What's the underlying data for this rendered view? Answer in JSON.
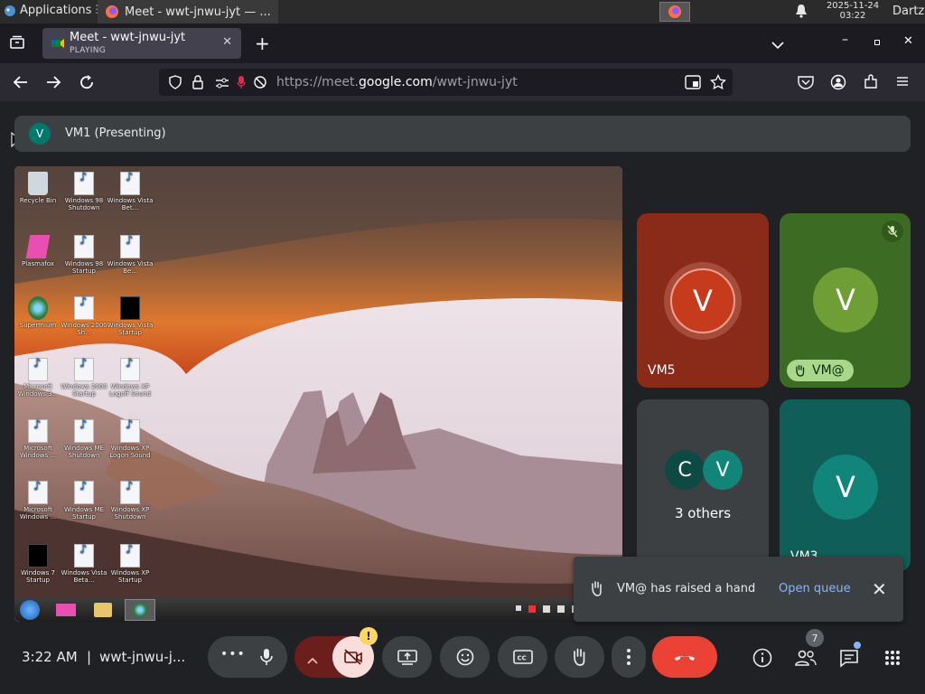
{
  "os": {
    "applications_label": "Applications",
    "task_title": "Meet - wwt-jnwu-jyt — ...",
    "clock_date": "2025-11-24",
    "clock_time": "03:22",
    "user": "Dartz"
  },
  "browser": {
    "tab_title": "Meet - wwt-jnwu-jyt",
    "tab_subtitle": "PLAYING",
    "url_prefix": "https://meet.",
    "url_domain": "google.com",
    "url_path": "/wwt-jnwu-jyt"
  },
  "meet": {
    "presenter_initial": "V",
    "presenter_label": "VM1 (Presenting)",
    "tiles": [
      {
        "initial": "V",
        "name": "VM5",
        "bg": "#8a2a18",
        "avatar": "#c53b1c"
      },
      {
        "initial": "V",
        "name": "VM@",
        "bg": "#3c6b23",
        "avatar": "#6f9e37"
      },
      {
        "others_initials": [
          "C",
          "V"
        ],
        "label": "3 others",
        "bg": "#3c4043"
      },
      {
        "initial": "V",
        "name": "VM3",
        "bg": "#0f5e58",
        "avatar": "#12857b"
      }
    ],
    "toast": {
      "message": "VM@ has raised a hand",
      "link": "Open queue"
    },
    "footer": {
      "time": "3:22 AM",
      "separator": "|",
      "meeting_code": "wwt-jnwu-j...",
      "people_count": "7",
      "camera_warning": "!"
    }
  },
  "desktop_icons": [
    "Recycle Bin",
    "Windows 98 Shutdown",
    "Windows Vista Bet...",
    "Plasmafox",
    "Windows 98 Startup",
    "Windows Vista Be...",
    "Supermium",
    "Windows 2000 Sh...",
    "Windows Vista Startup",
    "Microsoft Windows 3...",
    "Windows 2000 Startup",
    "Windows XP Logoff Sound",
    "Microsoft Windows ...",
    "Windows ME Shutdown",
    "Windows XP Logon Sound",
    "Microsoft Windows ...",
    "Windows ME Startup",
    "Windows XP Shutdown",
    "Windows 7 Startup",
    "Windows Vista Beta...",
    "Windows XP Startup"
  ],
  "colors": {
    "end_call": "#ea4335",
    "camera_off": "#6b1e1b",
    "accent_link": "#8ab4f8"
  }
}
